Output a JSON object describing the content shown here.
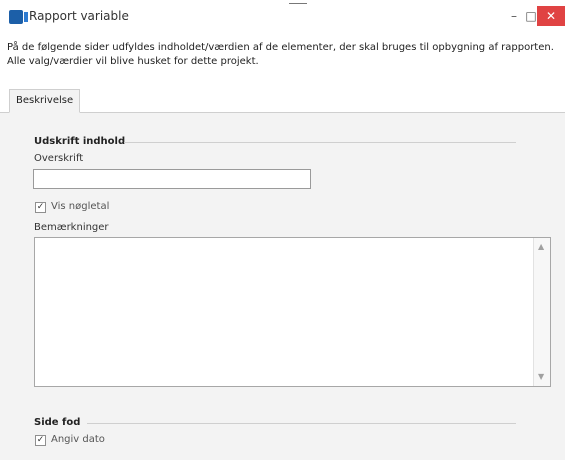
{
  "window": {
    "title": "Rapport variable",
    "controls": {
      "minimize": "–",
      "maximize": "□",
      "close": "✕"
    }
  },
  "instructions": {
    "line1": "På de følgende sider udfyldes indholdet/værdien af de elementer, der skal bruges til opbygning af rapporten.",
    "line2": "Alle valg/værdier vil blive husket for dette projekt."
  },
  "tabs": [
    {
      "label": "Beskrivelse",
      "active": true
    }
  ],
  "sections": {
    "print_content": {
      "header": "Udskrift indhold",
      "heading_label": "Overskrift",
      "heading_value": "",
      "show_keyfigures_label": "Vis nøgletal",
      "show_keyfigures_checked": true,
      "remarks_label": "Bemærkninger",
      "remarks_value": ""
    },
    "footer": {
      "header": "Side fod",
      "show_date_label": "Angiv dato",
      "show_date_checked": true
    }
  },
  "icons": {
    "app": "report-app-icon",
    "check": "✓",
    "scroll_up": "▲",
    "scroll_down": "▼"
  },
  "colors": {
    "close_button": "#e04343",
    "content_bg": "#f3f3f3",
    "app_icon": "#1c5fa8"
  }
}
